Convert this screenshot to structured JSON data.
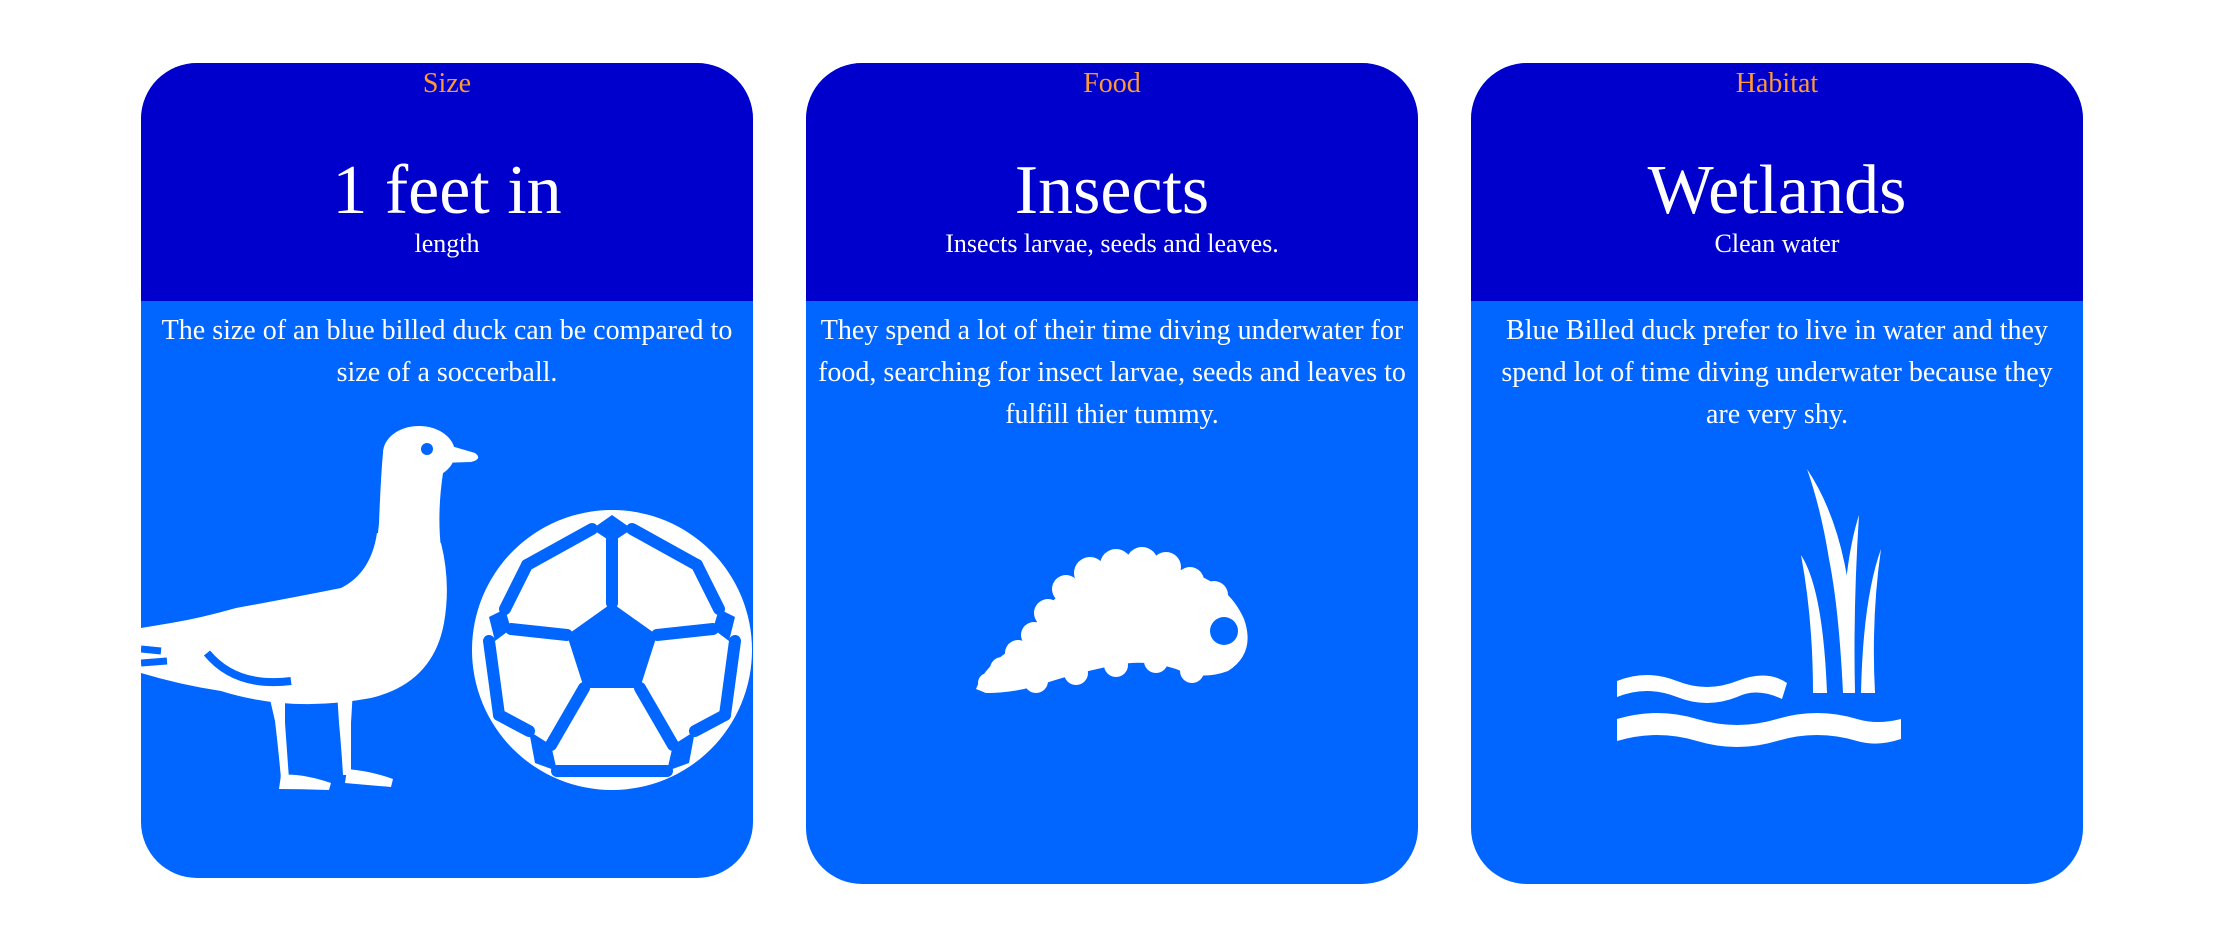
{
  "colors": {
    "page_background": "#ffffff",
    "card_header": "#0000cc",
    "card_body": "#0066ff",
    "label_text": "#ff9933",
    "main_text": "#ffffff"
  },
  "cards": [
    {
      "label": "Size",
      "title": "1 feet in",
      "subtitle": "length",
      "description": "The size of an blue billed duck can be compared to size of a soccerball.",
      "icons": [
        "duck-icon",
        "soccer-ball-icon"
      ]
    },
    {
      "label": "Food",
      "title": "Insects",
      "subtitle": "Insects larvae, seeds and leaves.",
      "description": "They spend a lot of their time diving underwater for food, searching for insect larvae, seeds and leaves to fulfill thier tummy.",
      "icons": [
        "larva-icon"
      ]
    },
    {
      "label": "Habitat",
      "title": "Wetlands",
      "subtitle": "Clean water",
      "description": "Blue Billed duck prefer to live in water and they spend lot of time diving underwater because they are very shy.",
      "icons": [
        "wetland-reeds-icon"
      ]
    }
  ]
}
